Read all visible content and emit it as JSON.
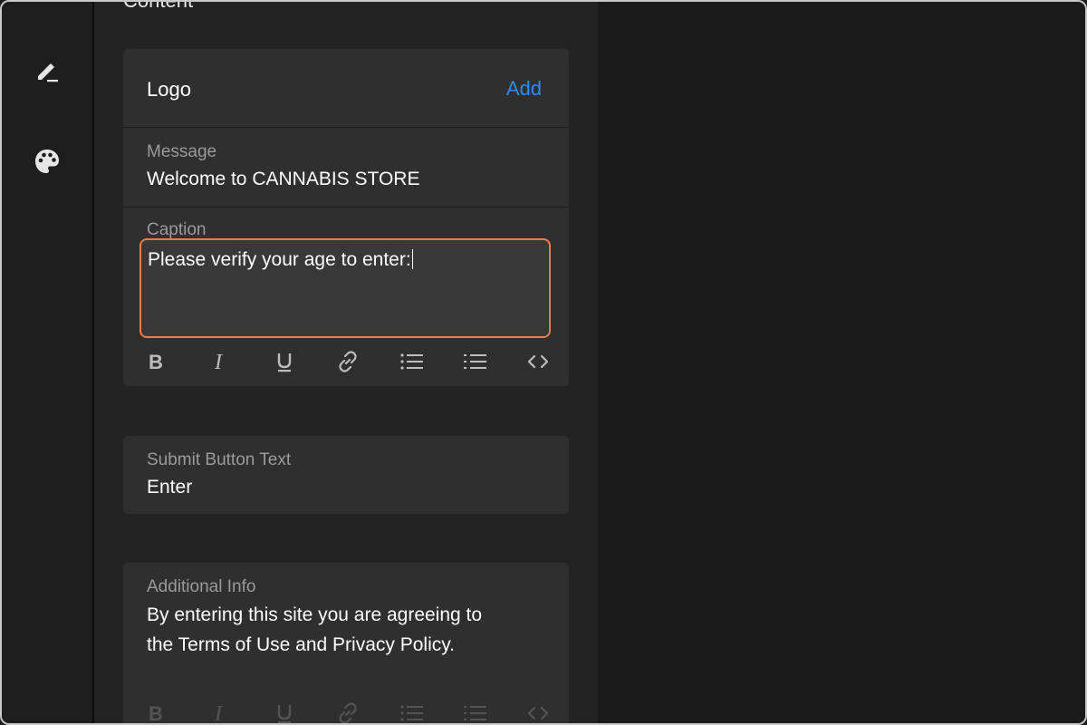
{
  "sidebar": {
    "icons": [
      {
        "name": "edit-pen-icon"
      },
      {
        "name": "palette-icon"
      }
    ]
  },
  "panel": {
    "section_title": "Content",
    "logo": {
      "label": "Logo",
      "add_label": "Add"
    },
    "message": {
      "label": "Message",
      "value": "Welcome to CANNABIS STORE"
    },
    "caption": {
      "label": "Caption",
      "value": "Please verify your age to enter:"
    },
    "caption_toolbar": [
      "bold-icon",
      "italic-icon",
      "underline-icon",
      "link-icon",
      "bulleted-list-icon",
      "numbered-list-icon",
      "code-icon"
    ],
    "submit_button": {
      "label": "Submit Button Text",
      "value": "Enter"
    },
    "additional_info": {
      "label": "Additional Info",
      "value_line1": "By entering this site you are agreeing to",
      "value_line2": "the Terms of Use and Privacy Policy."
    }
  },
  "colors": {
    "focus_border": "#f07d47",
    "link": "#2d8cf0"
  }
}
